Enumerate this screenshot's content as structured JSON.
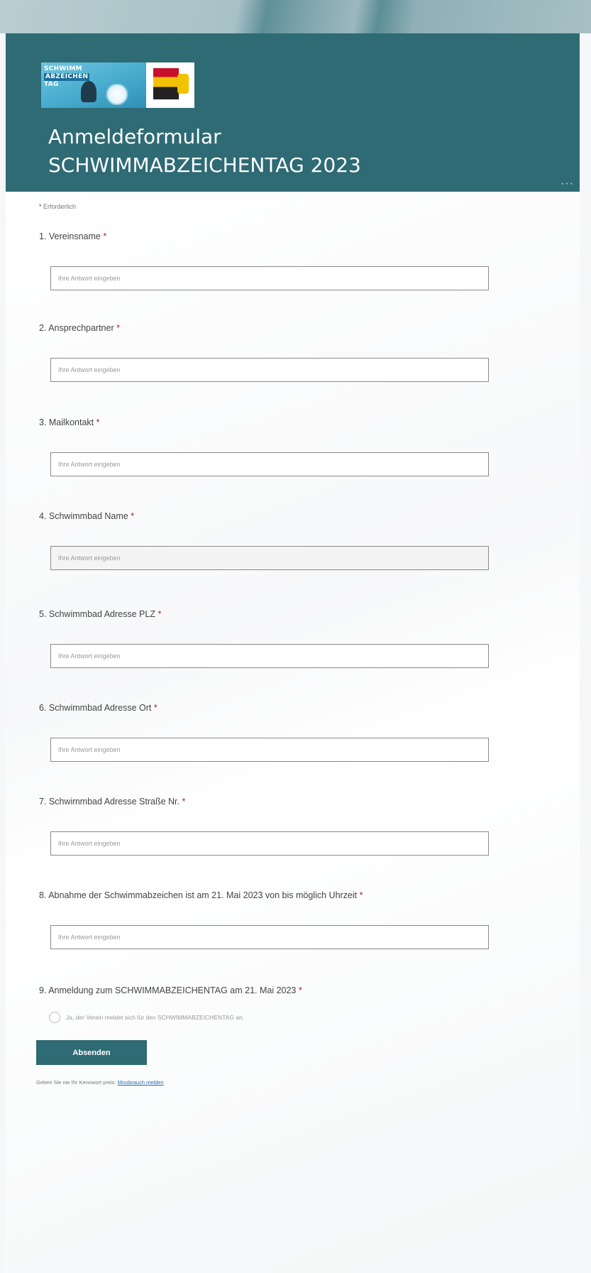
{
  "header": {
    "logo_lines": [
      "SCHWIMM",
      "ABZEICHEN",
      "TAG"
    ],
    "title_line1": "Anmeldeformular",
    "title_line2": "SCHWIMMABZEICHENTAG 2023",
    "more_icon": "more-dots-icon",
    "colors": {
      "header_bg": "#2e6b74",
      "required_star": "#a4262c",
      "link": "#2b6cb0"
    }
  },
  "form": {
    "required_star": "*",
    "required_label": "Erforderlich",
    "placeholder": "Ihre Antwort eingeben",
    "questions": [
      {
        "label": "1. Vereinsname"
      },
      {
        "label": "2. Ansprechpartner"
      },
      {
        "label": "3. Mailkontakt"
      },
      {
        "label": "4. Schwimmbad Name"
      },
      {
        "label": "5. Schwimmbad Adresse PLZ"
      },
      {
        "label": "6. Schwimmbad Adresse Ort"
      },
      {
        "label": "7. Schwimmbad Adresse Straße Nr."
      },
      {
        "label": "8. Abnahme der Schwimmabzeichen ist am 21. Mai 2023  von bis möglich Uhrzeit"
      },
      {
        "label": "9. Anmeldung zum SCHWIMMABZEICHENTAG am 21. Mai 2023",
        "option": "Ja, der Verein meldet sich für den SCHWIMMABZEICHENTAG an."
      }
    ],
    "submit_label": "Absenden"
  },
  "footer": {
    "text": "Geben Sie nie Ihr Kennwort preis.",
    "report_link": "Missbrauch melden"
  }
}
